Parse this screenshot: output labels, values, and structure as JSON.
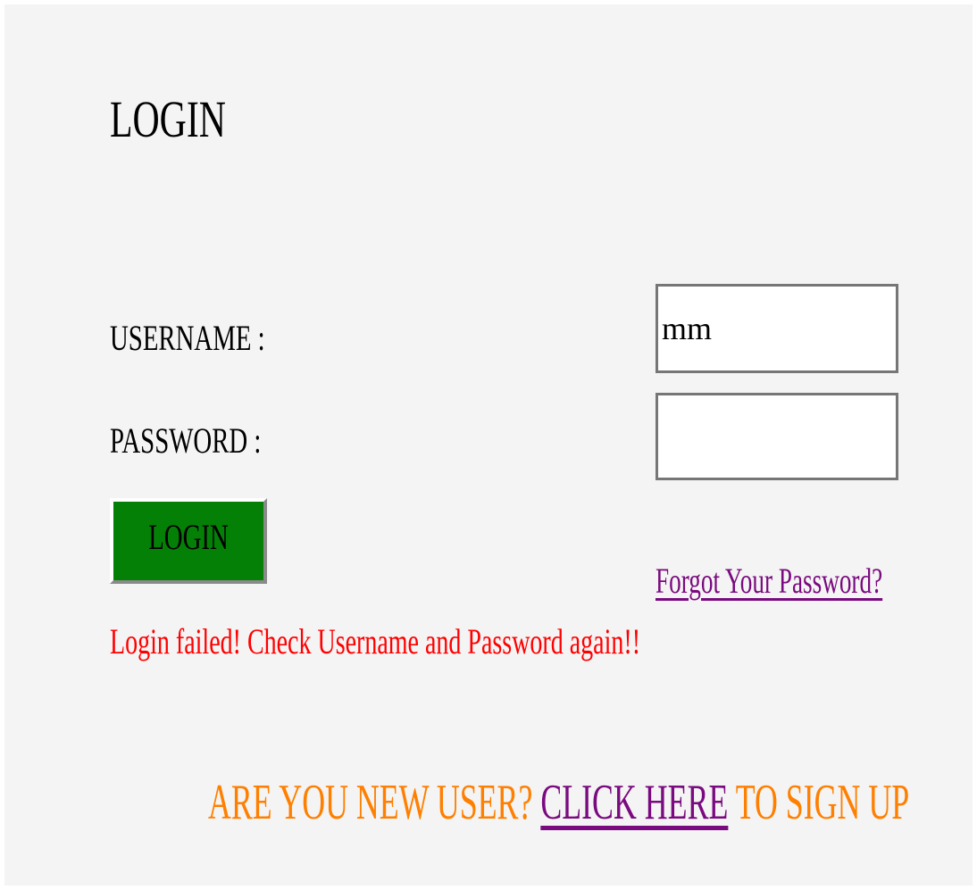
{
  "page": {
    "title": "LOGIN"
  },
  "form": {
    "username_label": "USERNAME :",
    "username_value": "mm",
    "password_label": "PASSWORD :",
    "password_value": "",
    "login_button": "LOGIN",
    "forgot_link": "Forgot Your Password?",
    "error_message": "Login failed! Check Username and Password again!!"
  },
  "signup": {
    "prefix": "ARE YOU NEW USER?",
    "link": "CLICK HERE",
    "suffix": "TO SIGN UP"
  },
  "colors": {
    "background": "#f4f4f4",
    "button": "#058007",
    "link": "#7a0a7f",
    "error": "#ff0000",
    "signup_text": "#ff7f00"
  }
}
